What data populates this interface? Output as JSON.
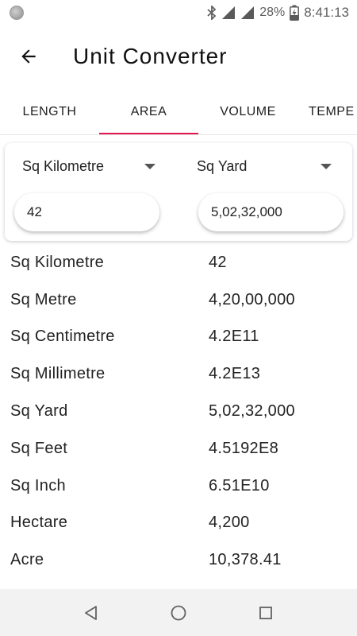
{
  "status_bar": {
    "battery": "28%",
    "time": "8:41:13",
    "icons": [
      "notification-dot-icon",
      "bluetooth-icon",
      "signal-icon",
      "signal-icon",
      "battery-charging-icon"
    ]
  },
  "app_bar": {
    "title": "Unit Converter",
    "back_icon": "arrow-back-icon"
  },
  "tabs": [
    {
      "label": "LENGTH",
      "active": false
    },
    {
      "label": "AREA",
      "active": true
    },
    {
      "label": "VOLUME",
      "active": false
    },
    {
      "label": "TEMPE",
      "active": false
    }
  ],
  "converter": {
    "from_unit": "Sq Kilometre",
    "to_unit": "Sq Yard",
    "from_value": "42",
    "to_value": "5,02,32,000"
  },
  "results": [
    {
      "unit": "Sq Kilometre",
      "value": "42"
    },
    {
      "unit": "Sq Metre",
      "value": "4,20,00,000"
    },
    {
      "unit": "Sq Centimetre",
      "value": "4.2E11"
    },
    {
      "unit": "Sq Millimetre",
      "value": "4.2E13"
    },
    {
      "unit": "Sq Yard",
      "value": "5,02,32,000"
    },
    {
      "unit": "Sq Feet",
      "value": "4.5192E8"
    },
    {
      "unit": "Sq Inch",
      "value": "6.51E10"
    },
    {
      "unit": "Hectare",
      "value": "4,200"
    },
    {
      "unit": "Acre",
      "value": "10,378.41"
    }
  ],
  "nav_bar": {
    "icons": [
      "back-triangle-icon",
      "home-circle-icon",
      "recents-square-icon"
    ]
  },
  "colors": {
    "accent": "#e2174e",
    "text": "#212121",
    "nav_bg": "#f2f2f2"
  }
}
